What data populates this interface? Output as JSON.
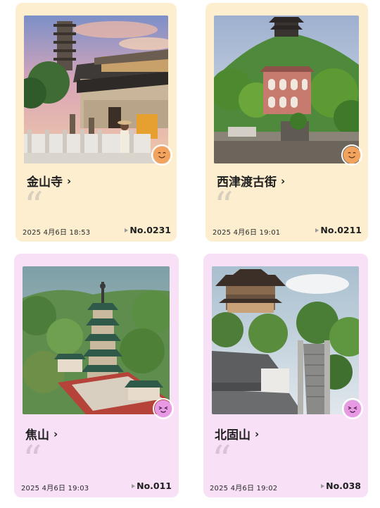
{
  "cards": [
    {
      "title": "金山寺",
      "chevron": "›",
      "quote_mark": "“",
      "date": "2025   4月6日 18:53",
      "number": "No.0231",
      "stamp_icon": "smiley-face-orange-icon",
      "theme_color": "#fdeecf"
    },
    {
      "title": "西津渡古街",
      "chevron": "›",
      "quote_mark": "“",
      "date": "2025   4月6日 19:01",
      "number": "No.0211",
      "stamp_icon": "smiley-face-orange-icon",
      "theme_color": "#fdeecf"
    },
    {
      "title": "焦山",
      "chevron": "›",
      "quote_mark": "“",
      "date": "2025   4月6日 19:03",
      "number": "No.011",
      "stamp_icon": "smiley-face-pink-icon",
      "theme_color": "#f8e0f7"
    },
    {
      "title": "北固山",
      "chevron": "›",
      "quote_mark": "“",
      "date": "2025   4月6日 19:02",
      "number": "No.038",
      "stamp_icon": "smiley-face-pink-icon",
      "theme_color": "#f8e0f7"
    }
  ]
}
